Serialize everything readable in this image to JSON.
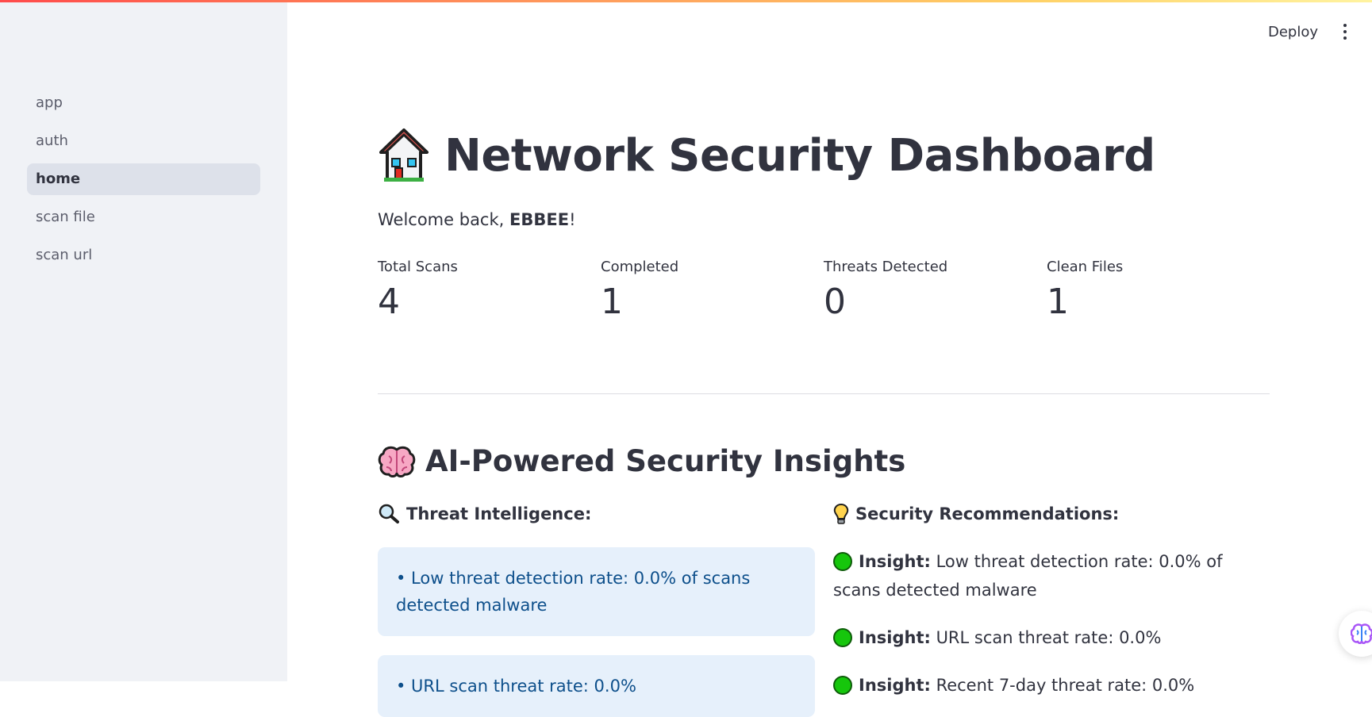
{
  "sidebar": {
    "items": [
      {
        "label": "app"
      },
      {
        "label": "auth"
      },
      {
        "label": "home"
      },
      {
        "label": "scan file"
      },
      {
        "label": "scan url"
      }
    ],
    "active": "home"
  },
  "header": {
    "deploy_label": "Deploy"
  },
  "page": {
    "title": "Network Security Dashboard",
    "welcome_prefix": "Welcome back, ",
    "username": "EBBEE",
    "welcome_suffix": "!"
  },
  "metrics": [
    {
      "label": "Total Scans",
      "value": "4"
    },
    {
      "label": "Completed",
      "value": "1"
    },
    {
      "label": "Threats Detected",
      "value": "0"
    },
    {
      "label": "Clean Files",
      "value": "1"
    }
  ],
  "insights": {
    "title": "AI-Powered Security Insights",
    "threat_intel": {
      "heading": "Threat Intelligence:",
      "items": [
        "• Low threat detection rate: 0.0% of scans detected malware",
        "• URL scan threat rate: 0.0%"
      ]
    },
    "recommendations": {
      "heading": "Security Recommendations:",
      "items": [
        {
          "label": "Insight:",
          "text": " Low threat detection rate: 0.0% of scans detected malware"
        },
        {
          "label": "Insight:",
          "text": " URL scan threat rate: 0.0%"
        },
        {
          "label": "Insight:",
          "text": " Recent 7-day threat rate: 0.0%"
        }
      ]
    }
  },
  "colors": {
    "accent": "#ff4b4b",
    "info_bg": "#e6f0fb",
    "info_text": "#0d4f8b",
    "status_green": "#16c60c"
  },
  "icons": [
    "house-icon",
    "brain-icon",
    "magnifier-icon",
    "lightbulb-icon",
    "green-circle-icon",
    "kebab-menu-icon",
    "assistant-brain-icon"
  ]
}
